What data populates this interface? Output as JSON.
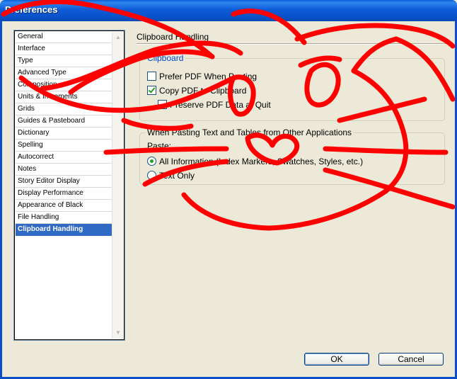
{
  "window": {
    "title": "Preferences"
  },
  "sidebar": {
    "items": [
      {
        "label": "General",
        "selected": false
      },
      {
        "label": "Interface",
        "selected": false
      },
      {
        "label": "Type",
        "selected": false
      },
      {
        "label": "Advanced Type",
        "selected": false
      },
      {
        "label": "Composition",
        "selected": false
      },
      {
        "label": "Units & Increments",
        "selected": false
      },
      {
        "label": "Grids",
        "selected": false
      },
      {
        "label": "Guides & Pasteboard",
        "selected": false
      },
      {
        "label": "Dictionary",
        "selected": false
      },
      {
        "label": "Spelling",
        "selected": false
      },
      {
        "label": "Autocorrect",
        "selected": false
      },
      {
        "label": "Notes",
        "selected": false
      },
      {
        "label": "Story Editor Display",
        "selected": false
      },
      {
        "label": "Display Performance",
        "selected": false
      },
      {
        "label": "Appearance of Black",
        "selected": false
      },
      {
        "label": "File Handling",
        "selected": false
      },
      {
        "label": "Clipboard Handling",
        "selected": true
      }
    ]
  },
  "main": {
    "title": "Clipboard Handling",
    "clipboard_group": {
      "legend": "Clipboard",
      "prefer_pdf": {
        "label": "Prefer PDF When Pasting",
        "checked": false
      },
      "copy_pdf": {
        "label": "Copy PDF to Clipboard",
        "checked": true
      },
      "preserve_pdf": {
        "label": "Preserve PDF Data at Quit",
        "checked": false
      }
    },
    "paste_group": {
      "legend": "When Pasting Text and Tables from Other Applications",
      "paste_label": "Paste:",
      "options": [
        {
          "label": "All Information (Index Markers, Swatches, Styles, etc.)",
          "selected": true
        },
        {
          "label": "Text Only",
          "selected": false
        }
      ]
    }
  },
  "buttons": {
    "ok": "OK",
    "cancel": "Cancel"
  },
  "colors": {
    "accent": "#316ac5",
    "titlebar": "#0a5fd6",
    "doodle": "#ff0000",
    "check": "#21a121"
  }
}
